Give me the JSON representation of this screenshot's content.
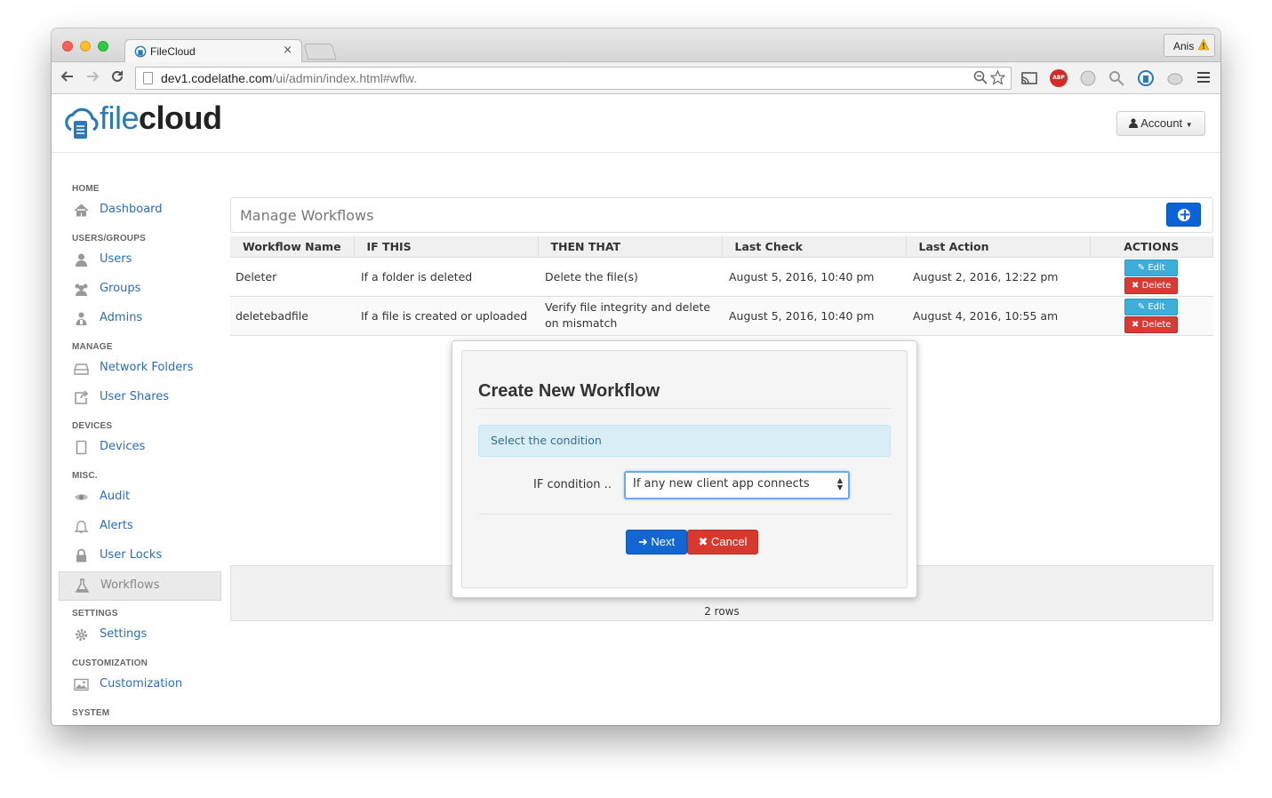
{
  "browser": {
    "tab_title": "FileCloud",
    "tab_close": "×",
    "profile_name": "Anis",
    "url_host": "dev1.codelathe.com",
    "url_path": "/ui/admin/index.html#wflw.",
    "extensions": [
      "cast-icon",
      "adblock-plus-icon",
      "extension-icon",
      "extension-icon",
      "filecloud-extension-icon",
      "extension-icon"
    ],
    "abp_label": "ABP"
  },
  "header": {
    "logo_part1": "file",
    "logo_part2": "cloud",
    "account_label": "Account"
  },
  "sidebar": {
    "sections": [
      {
        "title": "HOME",
        "items": [
          {
            "label": "Dashboard",
            "icon": "home-icon"
          }
        ]
      },
      {
        "title": "USERS/GROUPS",
        "items": [
          {
            "label": "Users",
            "icon": "user-icon"
          },
          {
            "label": "Groups",
            "icon": "users-icon"
          },
          {
            "label": "Admins",
            "icon": "admin-icon"
          }
        ]
      },
      {
        "title": "MANAGE",
        "items": [
          {
            "label": "Network Folders",
            "icon": "drive-icon"
          },
          {
            "label": "User Shares",
            "icon": "share-icon"
          }
        ]
      },
      {
        "title": "DEVICES",
        "items": [
          {
            "label": "Devices",
            "icon": "tablet-icon"
          }
        ]
      },
      {
        "title": "MISC.",
        "items": [
          {
            "label": "Audit",
            "icon": "eye-icon"
          },
          {
            "label": "Alerts",
            "icon": "bell-icon"
          },
          {
            "label": "User Locks",
            "icon": "lock-icon"
          },
          {
            "label": "Workflows",
            "icon": "flask-icon",
            "active": true
          }
        ]
      },
      {
        "title": "SETTINGS",
        "items": [
          {
            "label": "Settings",
            "icon": "gear-icon"
          }
        ]
      },
      {
        "title": "CUSTOMIZATION",
        "items": [
          {
            "label": "Customization",
            "icon": "picture-icon"
          }
        ]
      },
      {
        "title": "SYSTEM",
        "items": []
      }
    ]
  },
  "main": {
    "title": "Manage Workflows",
    "columns": [
      "Workflow Name",
      "IF THIS",
      "THEN THAT",
      "Last Check",
      "Last Action",
      "ACTIONS"
    ],
    "rows": [
      {
        "name": "Deleter",
        "if_this": "If a folder is deleted",
        "then_that": "Delete the file(s)",
        "last_check": "August 5, 2016, 10:40 pm",
        "last_action": "August 2, 2016, 12:22 pm"
      },
      {
        "name": "deletebadfile",
        "if_this": "If a file is created or uploaded",
        "then_that": "Verify file integrity and delete on mismatch",
        "last_check": "August 5, 2016, 10:40 pm",
        "last_action": "August 4, 2016, 10:55 am"
      }
    ],
    "edit_label": "Edit",
    "delete_label": "Delete",
    "rows_count": "2 rows"
  },
  "modal": {
    "title": "Create New Workflow",
    "info": "Select the condition",
    "condition_label": "IF condition ..",
    "condition_value": "If any new client app connects",
    "next_label": "Next",
    "cancel_label": "Cancel"
  },
  "colors": {
    "brand_blue": "#2a7ab8",
    "link_blue": "#2a6ebb",
    "primary_button": "#1466d2",
    "danger_button": "#d8392f",
    "info_button": "#3daed9"
  }
}
